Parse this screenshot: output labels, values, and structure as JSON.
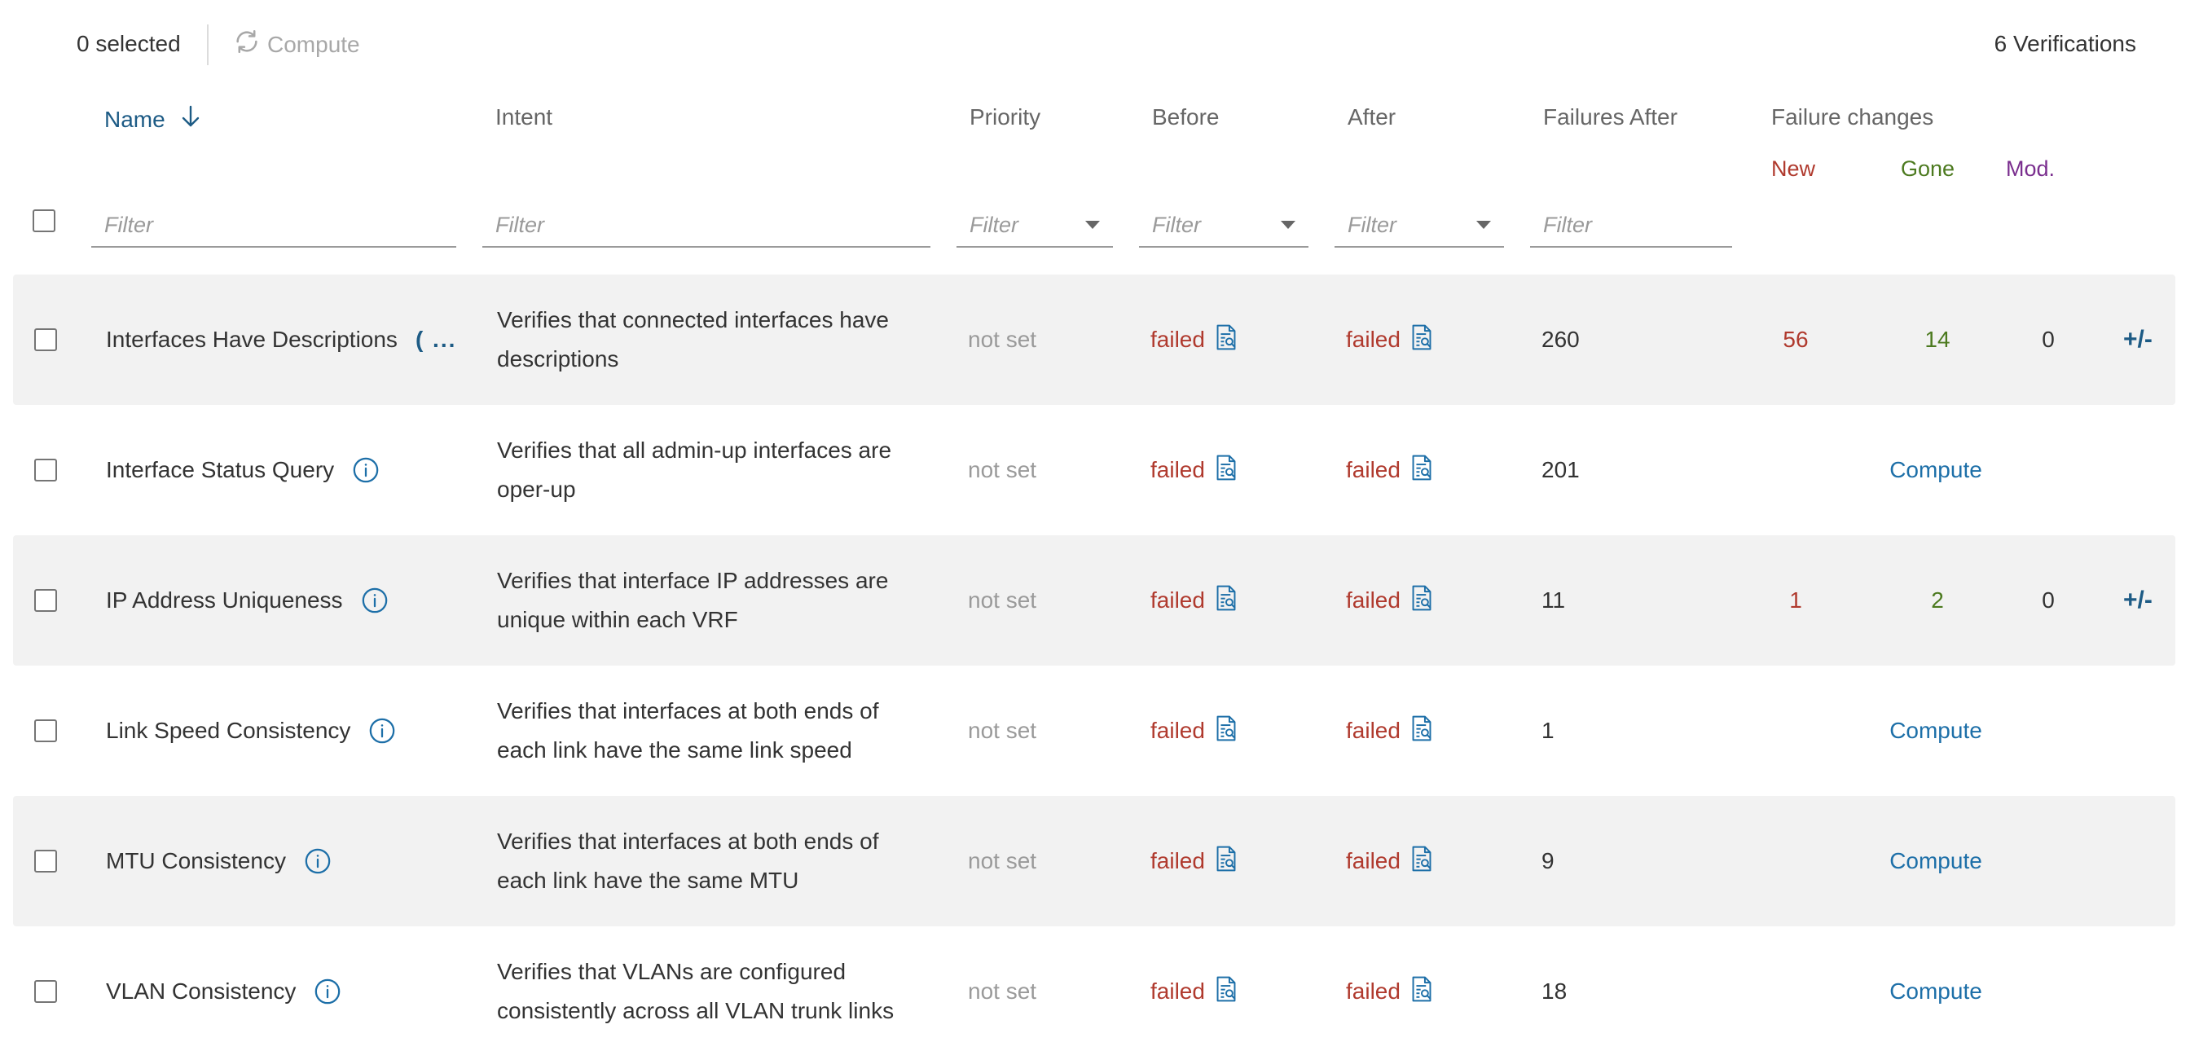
{
  "toolbar": {
    "selected_text": "0 selected",
    "compute_label": "Compute",
    "count_text": "6 Verifications"
  },
  "headers": {
    "name": "Name",
    "intent": "Intent",
    "priority": "Priority",
    "before": "Before",
    "after": "After",
    "failures_after": "Failures After",
    "failure_changes": "Failure changes",
    "new": "New",
    "gone": "Gone",
    "mod": "Mod."
  },
  "filters": {
    "name_placeholder": "Filter",
    "intent_placeholder": "Filter",
    "priority_value": "Filter",
    "before_value": "Filter",
    "after_value": "Filter",
    "failures_placeholder": "Filter"
  },
  "colors": {
    "link": "#1d5b85",
    "failed": "#b03a2e",
    "gone": "#4c7a1f",
    "mod": "#7a2e8e",
    "row_shade": "#f2f2f2"
  },
  "icons": {
    "sort": "arrow-down-icon",
    "compute": "refresh-icon",
    "info": "info-icon",
    "result": "document-search-icon",
    "diff": "plus-minus-icon"
  },
  "rows": [
    {
      "name": "Interfaces Have Descriptions",
      "name_truncated": "( ...",
      "intent": "Verifies that connected interfaces have descriptions",
      "priority": "not set",
      "before": "failed",
      "after": "failed",
      "failures_after": "260",
      "new": "56",
      "gone": "14",
      "mod": "0",
      "diff_label": "+/-"
    },
    {
      "name": "Interface Status Query",
      "intent": "Verifies that all admin-up interfaces are oper-up",
      "priority": "not set",
      "before": "failed",
      "after": "failed",
      "failures_after": "201",
      "compute_label": "Compute"
    },
    {
      "name": "IP Address Uniqueness",
      "intent": "Verifies that interface IP addresses are unique within each VRF",
      "priority": "not set",
      "before": "failed",
      "after": "failed",
      "failures_after": "11",
      "new": "1",
      "gone": "2",
      "mod": "0",
      "diff_label": "+/-"
    },
    {
      "name": "Link Speed Consistency",
      "intent": "Verifies that interfaces at both ends of each link have the same link speed",
      "priority": "not set",
      "before": "failed",
      "after": "failed",
      "failures_after": "1",
      "compute_label": "Compute"
    },
    {
      "name": "MTU Consistency",
      "intent": "Verifies that interfaces at both ends of each link have the same MTU",
      "priority": "not set",
      "before": "failed",
      "after": "failed",
      "failures_after": "9",
      "compute_label": "Compute"
    },
    {
      "name": "VLAN Consistency",
      "intent": "Verifies that VLANs are configured consistently across all VLAN trunk links",
      "priority": "not set",
      "before": "failed",
      "after": "failed",
      "failures_after": "18",
      "compute_label": "Compute"
    }
  ]
}
